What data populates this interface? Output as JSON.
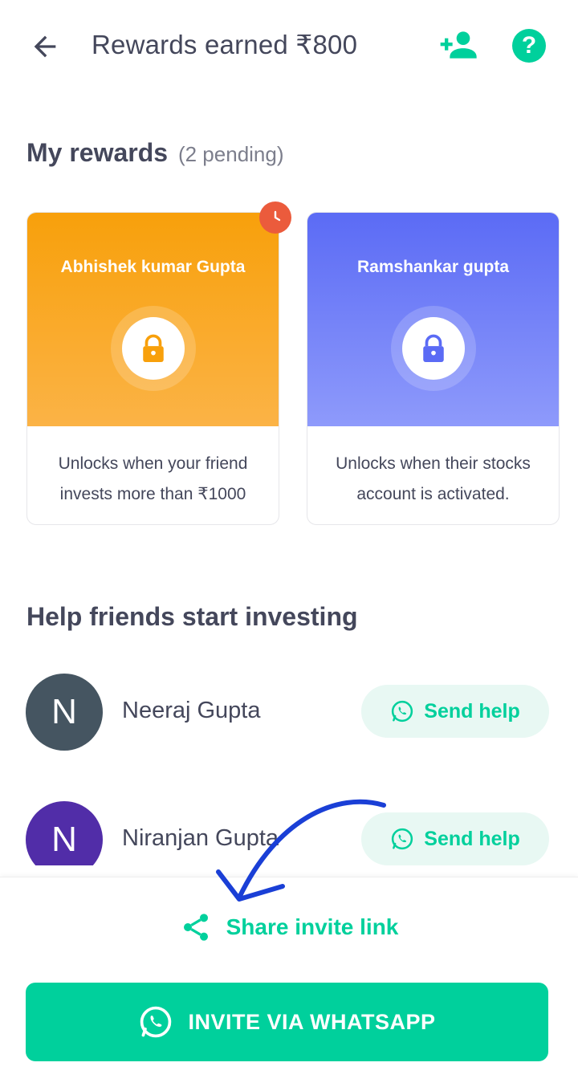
{
  "header": {
    "back_icon": "arrow-left-icon",
    "title": "Rewards earned ₹800",
    "add_friend_icon": "person-add-icon",
    "help_icon": "help-circle-icon",
    "help_glyph": "?"
  },
  "my_rewards": {
    "title": "My rewards",
    "pending": "(2 pending)",
    "cards": [
      {
        "name": "Abhishek kumar Gupta",
        "description": "Unlocks when your friend invests more than ₹1000",
        "badge_icon": "clock-icon",
        "color": "#f8a00b"
      },
      {
        "name": "Ramshankar gupta",
        "description": "Unlocks when their stocks account is activated.",
        "color": "#5b6bf5"
      }
    ]
  },
  "help_friends": {
    "title": "Help friends start investing",
    "friends": [
      {
        "initial": "N",
        "name": "Neeraj Gupta",
        "avatar_color": "#455561",
        "button_label": "Send help"
      },
      {
        "initial": "N",
        "name": "Niranjan Gupta",
        "avatar_color": "#512da8",
        "button_label": "Send help"
      }
    ]
  },
  "footer": {
    "share_label": "Share invite link",
    "share_icon": "share-icon",
    "whatsapp_label": "INVITE VIA WHATSAPP",
    "whatsapp_icon": "whatsapp-icon"
  },
  "colors": {
    "accent": "#00d09c",
    "text": "#44475b",
    "badge": "#eb5b3c",
    "annotation": "#1a3fd6"
  }
}
